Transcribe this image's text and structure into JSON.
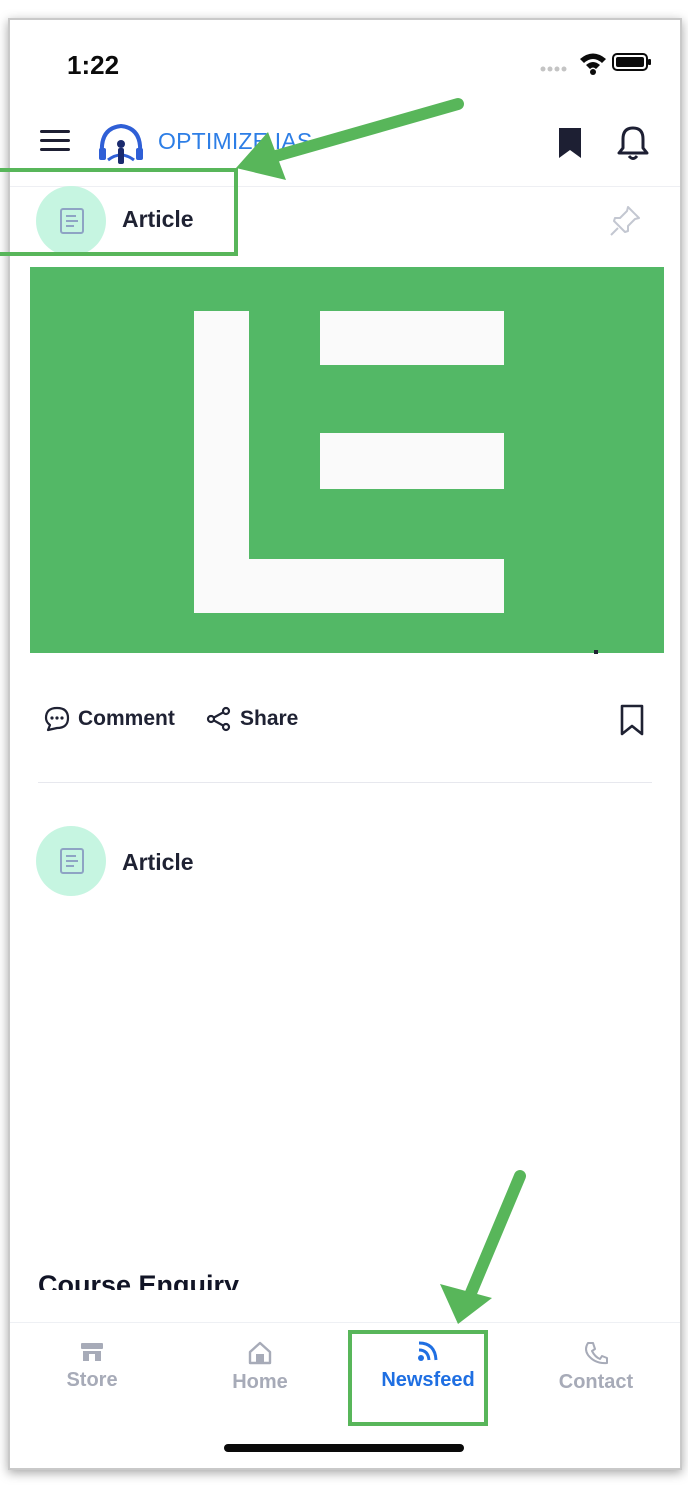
{
  "status_bar": {
    "time": "1:22"
  },
  "header": {
    "app_title": "OPTIMIZE IAS"
  },
  "feed": {
    "posts": [
      {
        "type_label": "Article",
        "image_letter": "E"
      },
      {
        "type_label": "Article"
      }
    ],
    "actions": {
      "comment_label": "Comment",
      "share_label": "Share"
    }
  },
  "course_enquiry": "Course Enquiry",
  "bottom_nav": {
    "items": [
      {
        "label": "Store",
        "icon": "store-icon"
      },
      {
        "label": "Home",
        "icon": "home-icon"
      },
      {
        "label": "Newsfeed",
        "icon": "rss-icon",
        "active": true
      },
      {
        "label": "Contact",
        "icon": "phone-icon"
      }
    ]
  },
  "colors": {
    "accent": "#1f6fe2",
    "annotation": "#58b65a",
    "article_image_bg": "#53b866",
    "avatar_bg": "#c6f5e1"
  }
}
